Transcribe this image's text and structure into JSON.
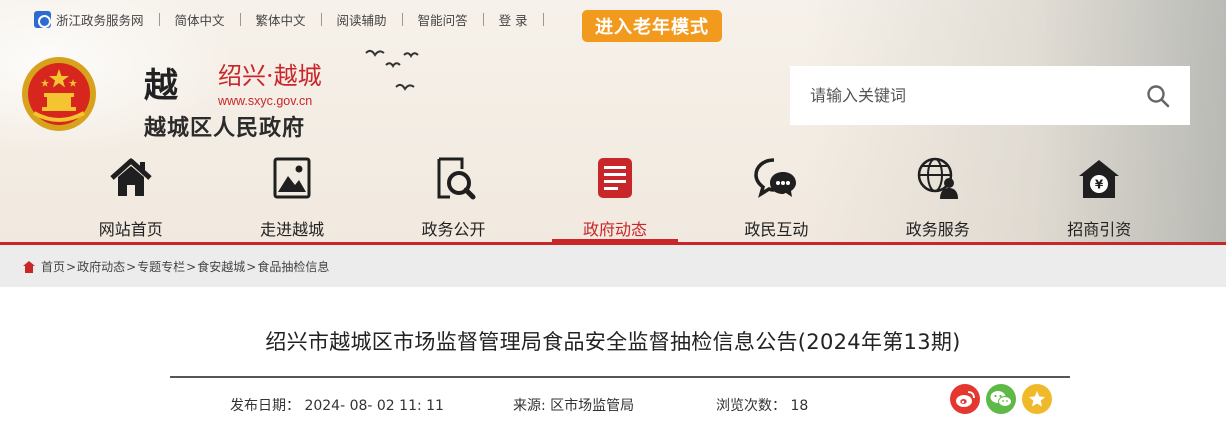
{
  "topbar": {
    "site_name": "浙江政务服务网",
    "links": [
      "简体中文",
      "繁体中文",
      "阅读辅助",
      "智能问答",
      "登 录"
    ],
    "elder_mode": "进入老年模式"
  },
  "logo": {
    "calligraphy": "越",
    "city": "绍兴·越城",
    "url": "www.sxyc.gov.cn",
    "name": "越城区人民政府"
  },
  "search": {
    "placeholder": "请输入关键词"
  },
  "nav": [
    {
      "label": "网站首页",
      "icon": "home-icon"
    },
    {
      "label": "走进越城",
      "icon": "picture-icon"
    },
    {
      "label": "政务公开",
      "icon": "document-search-icon"
    },
    {
      "label": "政府动态",
      "icon": "news-icon",
      "active": true
    },
    {
      "label": "政民互动",
      "icon": "chat-icon"
    },
    {
      "label": "政务服务",
      "icon": "globe-person-icon"
    },
    {
      "label": "招商引资",
      "icon": "yuan-house-icon"
    }
  ],
  "breadcrumb": [
    "首页",
    "政府动态",
    "专题专栏",
    "食安越城",
    "食品抽检信息"
  ],
  "article": {
    "title": "绍兴市越城区市场监督管理局食品安全监督抽检信息公告(2024年第13期)",
    "date_label": "发布日期：",
    "date_value": "2024- 08- 02 11: 11",
    "source_label": "来源:",
    "source_value": "区市场监管局",
    "views_label": "浏览次数：",
    "views_value": "18"
  },
  "colors": {
    "accent": "#c9262a",
    "elder_button": "#f29a1d",
    "weibo": "#e3372f",
    "wechat": "#5fb946",
    "favorite": "#f0b92a"
  }
}
